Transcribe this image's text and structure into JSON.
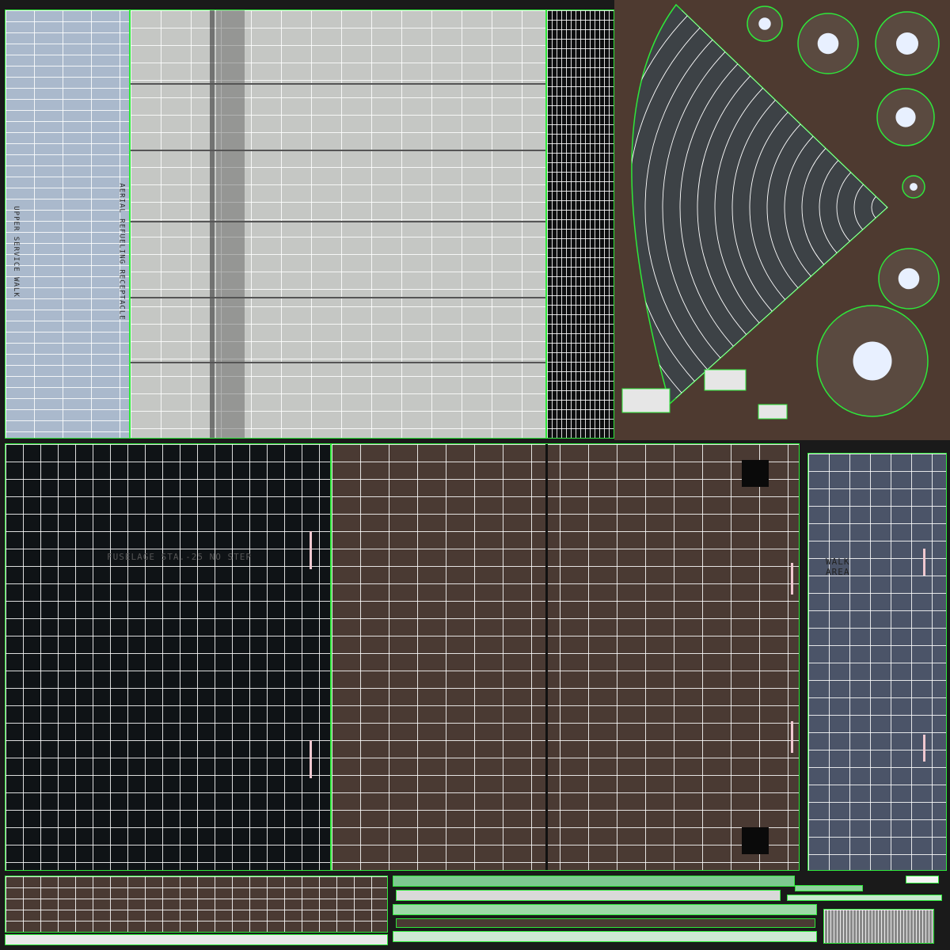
{
  "texture_labels": {
    "fuselage_vertical_1": "UPPER SERVICE WALK",
    "fuselage_vertical_2": "AERIAL REFUELING RECEPTACLE",
    "hull_stencil": "FUSELAGE STA.-25 NO STEP",
    "panel_stencil": "WALK\nAREA"
  },
  "colors": {
    "uv_border": "#2ee83a",
    "wire": "#ffffff",
    "light_metal": "#c9cbc8",
    "pale_blue": "#aab9cc",
    "dark_hull": "#111518",
    "rust_panel": "#4a3a33",
    "blue_panel": "#4a5366"
  }
}
